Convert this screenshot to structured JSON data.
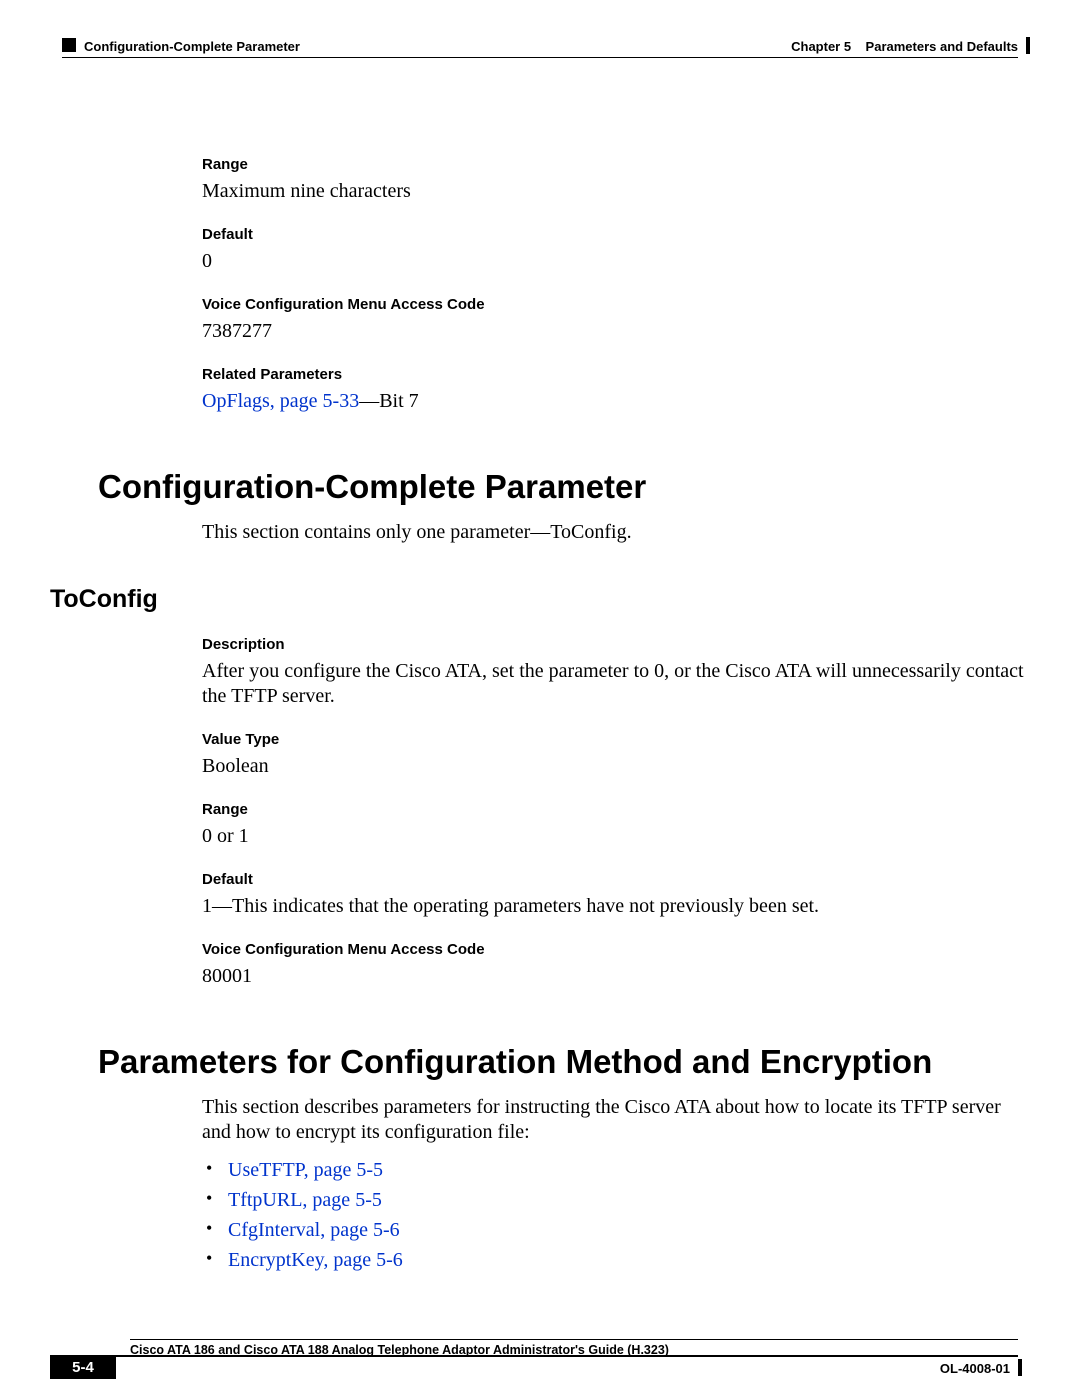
{
  "header": {
    "section_title": "Configuration-Complete Parameter",
    "chapter_label": "Chapter 5",
    "chapter_title": "Parameters and Defaults"
  },
  "top_fields": {
    "range_label": "Range",
    "range_value": "Maximum nine characters",
    "default_label": "Default",
    "default_value": "0",
    "voice_label": "Voice Configuration Menu Access Code",
    "voice_value": "7387277",
    "related_label": "Related Parameters",
    "related_link": "OpFlags, page 5-33",
    "related_suffix": "—Bit 7"
  },
  "section1": {
    "heading": "Configuration-Complete Parameter",
    "intro": "This section contains only one parameter—ToConfig."
  },
  "toconfig": {
    "heading": "ToConfig",
    "description_label": "Description",
    "description_value": "After you configure the Cisco ATA, set the parameter to 0, or the Cisco ATA will unnecessarily contact the TFTP server.",
    "valuetype_label": "Value Type",
    "valuetype_value": "Boolean",
    "range_label": "Range",
    "range_value": "0 or 1",
    "default_label": "Default",
    "default_value": "1—This indicates that the operating parameters have not previously been set.",
    "voice_label": "Voice Configuration Menu Access Code",
    "voice_value": "80001"
  },
  "section2": {
    "heading": "Parameters for Configuration Method and Encryption",
    "intro": "This section describes parameters for instructing the Cisco ATA about how to locate its TFTP server and how to encrypt its configuration file:",
    "bullets": [
      "UseTFTP, page 5-5",
      "TftpURL, page 5-5",
      "CfgInterval, page 5-6",
      "EncryptKey, page 5-6"
    ]
  },
  "footer": {
    "book_title": "Cisco ATA 186 and Cisco ATA 188 Analog Telephone Adaptor Administrator's Guide (H.323)",
    "page_number": "5-4",
    "doc_id": "OL-4008-01"
  }
}
